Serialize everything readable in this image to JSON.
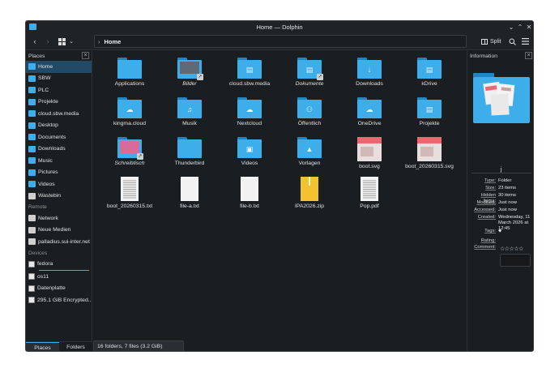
{
  "window": {
    "title": "Home — Dolphin"
  },
  "toolbar": {
    "breadcrumb": "Home",
    "split_label": "Split"
  },
  "places": {
    "title": "Places",
    "items": [
      "Home",
      "SBW",
      "PLC",
      "Projekte",
      "cloud.sbw.media",
      "Desktop",
      "Documents",
      "Downloads",
      "Music",
      "Pictures",
      "Videos",
      "Wastebin"
    ],
    "remote_title": "Remote",
    "remote_items": [
      "Network",
      "Neue Medien",
      "palladius.sui-inter.net"
    ],
    "devices_title": "Devices",
    "device_items": [
      "fedora",
      "os11",
      "Datenplatte",
      "295.1 GiB Encrypted..."
    ]
  },
  "bottom_tabs": [
    "Places",
    "Folders"
  ],
  "files": [
    {
      "name": "Applications",
      "kind": "folder"
    },
    {
      "name": "Bilder",
      "kind": "folder-thumb",
      "italic": true
    },
    {
      "name": "cloud.sbw.media",
      "kind": "folder"
    },
    {
      "name": "Dokumente",
      "kind": "folder",
      "italic": true
    },
    {
      "name": "Downloads",
      "kind": "folder"
    },
    {
      "name": "kDrive",
      "kind": "folder"
    },
    {
      "name": "kingma.cloud",
      "kind": "folder"
    },
    {
      "name": "Musik",
      "kind": "folder"
    },
    {
      "name": "Nextcloud",
      "kind": "folder"
    },
    {
      "name": "Öffentlich",
      "kind": "folder"
    },
    {
      "name": "OneDrive",
      "kind": "folder"
    },
    {
      "name": "Projekte",
      "kind": "folder"
    },
    {
      "name": "Schreibtisch",
      "kind": "folder-thumb",
      "italic": true
    },
    {
      "name": "Thunderbird",
      "kind": "folder"
    },
    {
      "name": "Videos",
      "kind": "folder"
    },
    {
      "name": "Vorlagen",
      "kind": "folder"
    },
    {
      "name": "boot.svg",
      "kind": "image"
    },
    {
      "name": "boot_20260315.svg",
      "kind": "image"
    },
    {
      "name": "boot_20260315.txt",
      "kind": "doc"
    },
    {
      "name": "file-a.txt",
      "kind": "blank"
    },
    {
      "name": "file-b.txt",
      "kind": "blank"
    },
    {
      "name": "IPA2026.zip",
      "kind": "zip"
    },
    {
      "name": "Pop.pdf",
      "kind": "doc"
    }
  ],
  "info": {
    "title": "Information",
    "name": "j",
    "rows": [
      {
        "k": "Type:",
        "v": "Folder"
      },
      {
        "k": "Size:",
        "v": "23 items"
      },
      {
        "k": "Hidden items:",
        "v": "30 items"
      },
      {
        "k": "Modified:",
        "v": "Just now"
      },
      {
        "k": "Accessed:",
        "v": "Just now"
      },
      {
        "k": "Created:",
        "v": "Wednesday, 11 March 2026 at 12:45"
      }
    ],
    "tags_label": "Tags:",
    "rating_label": "Rating:",
    "comment_label": "Comment:"
  },
  "status": "16 folders, 7 files (3.2 GiB)"
}
